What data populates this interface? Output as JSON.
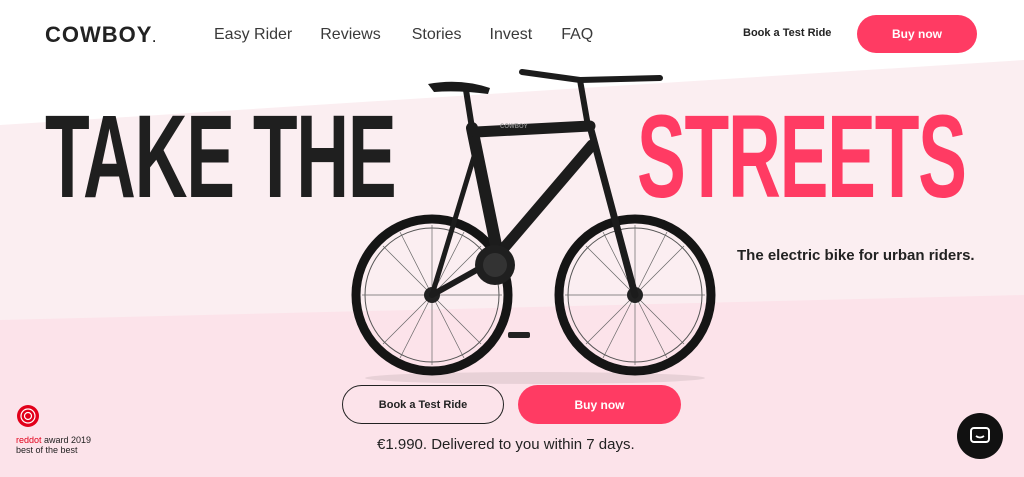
{
  "nav": {
    "logo": "COWBOY",
    "logo_mark": ".",
    "links": [
      "Easy Rider",
      "Reviews",
      "Stories",
      "Invest",
      "FAQ"
    ],
    "book_test_ride": "Book a Test Ride",
    "buy_now": "Buy now"
  },
  "hero": {
    "headline_left": "TAKE THE",
    "headline_right": "STREETS",
    "tagline": "The electric bike for urban riders.",
    "bike_brand": "COWBOY",
    "cta_book": "Book a Test Ride",
    "cta_buy": "Buy now",
    "price_line": "€1.990. Delivered to you within 7 days."
  },
  "award": {
    "red": "reddot",
    "line1": " award 2019",
    "line2": "best of the best"
  },
  "chat": {
    "icon": "chat-bubble-icon"
  },
  "colors": {
    "accent": "#ff3b63",
    "dark": "#1f1f1f",
    "pink_bg": "#fbe4ea"
  }
}
